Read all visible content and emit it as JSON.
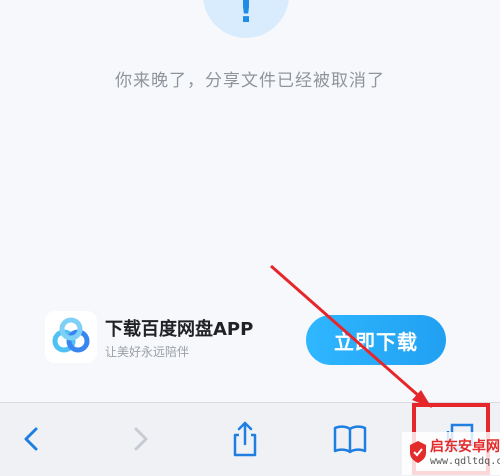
{
  "message": "你来晚了，分享文件已经被取消了",
  "alert_symbol": "!",
  "app_banner": {
    "name": "下载百度网盘APP",
    "slogan": "让美好永远陪伴",
    "button_label": "立即下载"
  },
  "toolbar": {
    "icons": [
      "back-icon",
      "forward-icon",
      "share-icon",
      "bookmarks-icon",
      "tabs-icon"
    ]
  },
  "watermark": {
    "line1": "启东安卓网",
    "line2": "www.qdltdq.com"
  },
  "colors": {
    "accent": "#21a0f2",
    "highlight": "#e5262b",
    "icon": "#1f7fe0"
  }
}
